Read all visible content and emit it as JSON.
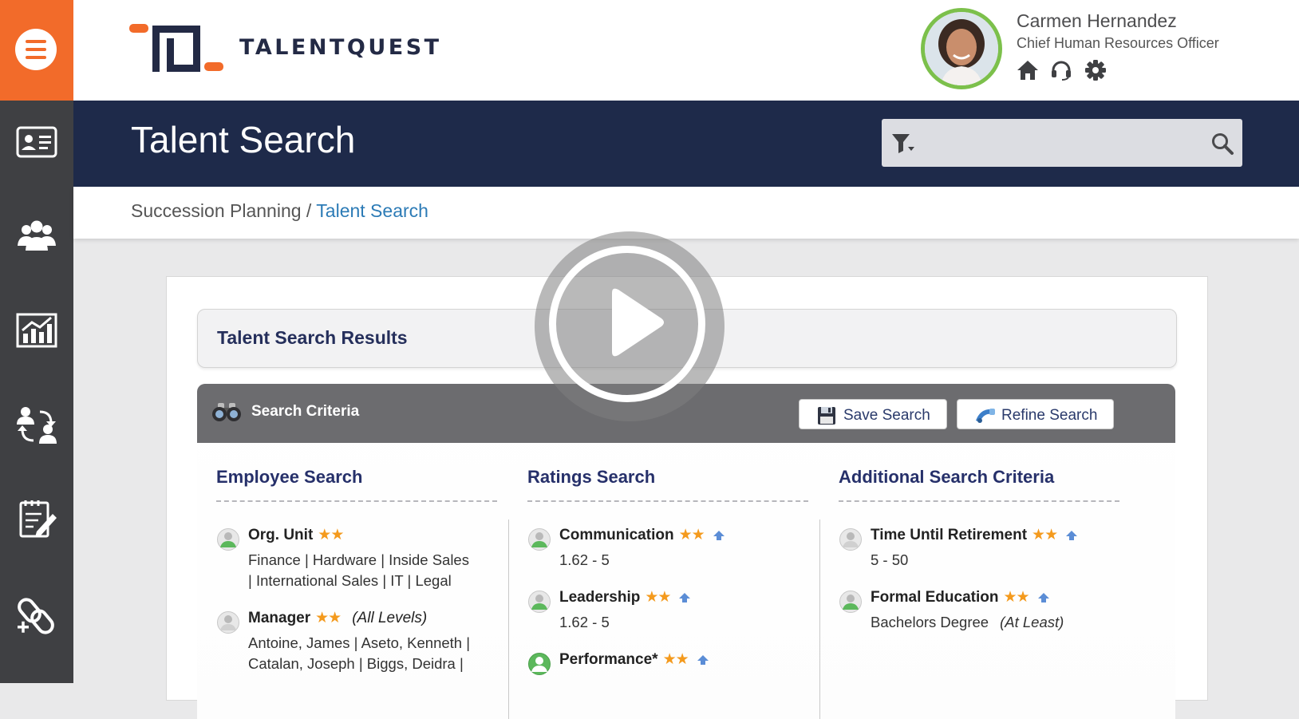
{
  "app": {
    "logo_text": "TALENTQUEST",
    "brand_orange": "#f26b2a",
    "brand_navy": "#1e2a4a"
  },
  "sidebar": {
    "menu_icon": "hamburger-icon",
    "items": [
      {
        "icon": "profile-card-icon"
      },
      {
        "icon": "team-icon"
      },
      {
        "icon": "analytics-chart-icon"
      },
      {
        "icon": "succession-swap-icon"
      },
      {
        "icon": "edit-notes-icon"
      },
      {
        "icon": "links-add-icon"
      }
    ]
  },
  "user": {
    "name": "Carmen Hernandez",
    "role": "Chief Human Resources Officer",
    "icons": [
      "home-icon",
      "headset-icon",
      "gear-icon"
    ]
  },
  "header": {
    "title": "Talent Search",
    "search_value": ""
  },
  "breadcrumb": {
    "parent": "Succession Planning",
    "separator": "/",
    "current": "Talent Search"
  },
  "results": {
    "title": "Talent Search Results"
  },
  "criteria": {
    "title": "Search Criteria",
    "save_label": "Save Search",
    "refine_label": "Refine Search",
    "columns": [
      {
        "title": "Employee Search",
        "items": [
          {
            "label": "Org. Unit",
            "stars": "★★",
            "lines": [
              "Finance  | Hardware  | Inside Sales",
              "| International Sales  | IT  | Legal"
            ]
          },
          {
            "label": "Manager",
            "stars": "★★",
            "note": "(All Levels)",
            "lines": [
              "Antoine, James  | Aseto, Kenneth  |",
              "Catalan, Joseph  | Biggs, Deidra  |"
            ]
          }
        ]
      },
      {
        "title": "Ratings Search",
        "items": [
          {
            "label": "Communication",
            "stars": "★★",
            "lines": [
              "1.62 - 5"
            ]
          },
          {
            "label": "Leadership",
            "stars": "★★",
            "lines": [
              "1.62 - 5"
            ]
          },
          {
            "label": "Performance*",
            "stars": "★★",
            "lines": []
          }
        ]
      },
      {
        "title": "Additional Search Criteria",
        "items": [
          {
            "label": "Time Until Retirement",
            "stars": "★★",
            "lines": [
              "5 - 50"
            ]
          },
          {
            "label": "Formal Education",
            "stars": "★★",
            "lines": [
              "Bachelors Degree"
            ],
            "note": "(At Least)"
          }
        ]
      }
    ]
  },
  "video": {
    "icon": "play-icon"
  }
}
